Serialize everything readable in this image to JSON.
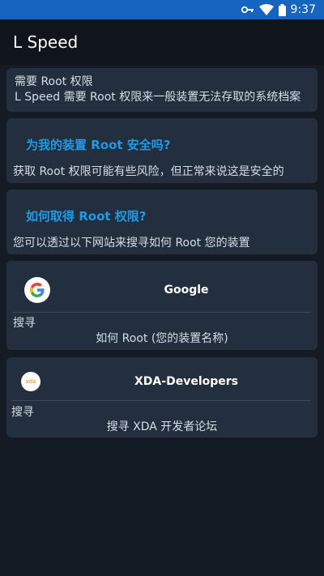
{
  "status_bar": {
    "time": "9:37",
    "icons": [
      "key-icon",
      "wifi-icon",
      "battery-icon"
    ]
  },
  "app_bar": {
    "title": "L Speed"
  },
  "root_required": {
    "title": "需要 Root 权限",
    "body": "L Speed 需要 Root 权限来一般装置无法存取的系统档案"
  },
  "safety_card": {
    "title": "为我的装置 Root 安全吗?",
    "body": "获取 Root 权限可能有些风险，但正常来说这是安全的"
  },
  "howto_card": {
    "title": "如何取得 Root 权限?",
    "body": "您可以透过以下网站来搜寻如何 Root 您的装置"
  },
  "google_card": {
    "name": "Google",
    "search_label": "搜寻",
    "link": "如何 Root (您的装置名称)",
    "icon": "google-logo-icon"
  },
  "xda_card": {
    "name": "XDA-Developers",
    "logo_text": "xda",
    "search_label": "搜寻",
    "link": "搜寻 XDA 开发者论坛",
    "icon": "xda-logo-icon"
  },
  "colors": {
    "status_bar": "#1565c0",
    "app_bar": "#10151c",
    "background": "#151b24",
    "card": "#232f3e",
    "accent": "#1e9be6"
  }
}
